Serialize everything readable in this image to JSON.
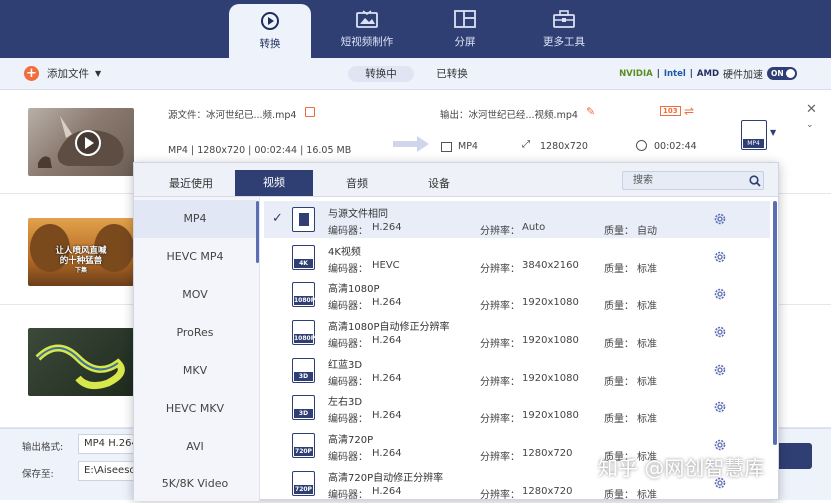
{
  "nav": {
    "tabs": [
      {
        "label": "转换",
        "icon": "convert-icon"
      },
      {
        "label": "短视频制作",
        "icon": "mv-icon"
      },
      {
        "label": "分屏",
        "icon": "collage-icon"
      },
      {
        "label": "更多工具",
        "icon": "toolbox-icon"
      }
    ]
  },
  "toolbar": {
    "add_label": "添加文件",
    "seg_converting": "转换中",
    "seg_converted": "已转换",
    "hw_nvidia": "NVIDIA",
    "hw_intel": "Intel",
    "hw_amd": "AMD",
    "hw_accel": "硬件加速",
    "hw_toggle": "ON"
  },
  "files": [
    {
      "source": "源文件：冰河世纪已...频.mp4",
      "meta": "MP4 | 1280x720 | 00:02:44 | 16.05 MB",
      "output": "输出：冰河世纪已经...视频.mp4",
      "out_format": "MP4",
      "out_res": "1280x720",
      "out_dur": "00:02:44",
      "badge1": "103",
      "format_tag": "MP4"
    }
  ],
  "thumbs": {
    "t2_line1": "让人喷风直喊",
    "t2_line2": "的十种猛兽",
    "t2_line3": "下集"
  },
  "bottom": {
    "output_format_label": "输出格式:",
    "output_format_value": "MP4 H.264",
    "save_label": "保存至:",
    "save_value": "E:\\Aiseesoft"
  },
  "dropdown": {
    "tabs": [
      "最近使用",
      "视频",
      "音频",
      "设备"
    ],
    "search_placeholder": "搜索",
    "formats": [
      "MP4",
      "HEVC MP4",
      "MOV",
      "ProRes",
      "MKV",
      "HEVC MKV",
      "AVI",
      "5K/8K Video"
    ],
    "encoder_label": "编码器：",
    "res_label": "分辨率：",
    "quality_label": "质量：",
    "presets": [
      {
        "name": "与源文件相同",
        "encoder": "H.264",
        "res": "Auto",
        "quality": "自动",
        "tag": ""
      },
      {
        "name": "4K视频",
        "encoder": "HEVC",
        "res": "3840x2160",
        "quality": "标准",
        "tag": "4K"
      },
      {
        "name": "高清1080P",
        "encoder": "H.264",
        "res": "1920x1080",
        "quality": "标准",
        "tag": "1080P"
      },
      {
        "name": "高清1080P自动修正分辨率",
        "encoder": "H.264",
        "res": "1920x1080",
        "quality": "标准",
        "tag": "1080P"
      },
      {
        "name": "红蓝3D",
        "encoder": "H.264",
        "res": "1920x1080",
        "quality": "标准",
        "tag": "3D"
      },
      {
        "name": "左右3D",
        "encoder": "H.264",
        "res": "1920x1080",
        "quality": "标准",
        "tag": "3D"
      },
      {
        "name": "高清720P",
        "encoder": "H.264",
        "res": "1280x720",
        "quality": "标准",
        "tag": "720P"
      },
      {
        "name": "高清720P自动修正分辨率",
        "encoder": "H.264",
        "res": "1280x720",
        "quality": "标准",
        "tag": "720P"
      }
    ]
  },
  "watermark": "知乎 @网创智慧库",
  "colors": {
    "nav": "#2f3f73",
    "accent": "#f26c3c",
    "panel": "#eef2fb"
  }
}
